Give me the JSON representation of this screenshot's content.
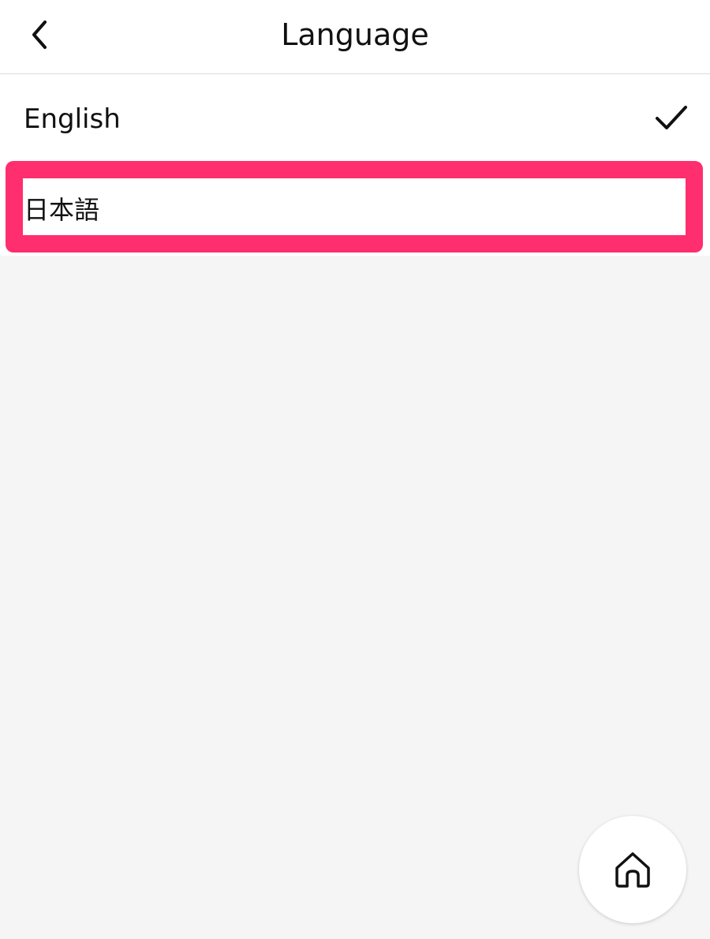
{
  "header": {
    "title": "Language",
    "back_icon": "chevron-left-icon"
  },
  "languages": [
    {
      "label": "English",
      "selected": true,
      "icon": "check-icon"
    },
    {
      "label": "日本語",
      "selected": false
    }
  ],
  "highlight": {
    "target": "日本語",
    "color": "#ff2e6e"
  },
  "home_button": {
    "icon": "home-icon"
  },
  "colors": {
    "background": "#f5f5f5",
    "surface": "#ffffff",
    "text": "#111111",
    "divider": "#dcdcdc"
  }
}
